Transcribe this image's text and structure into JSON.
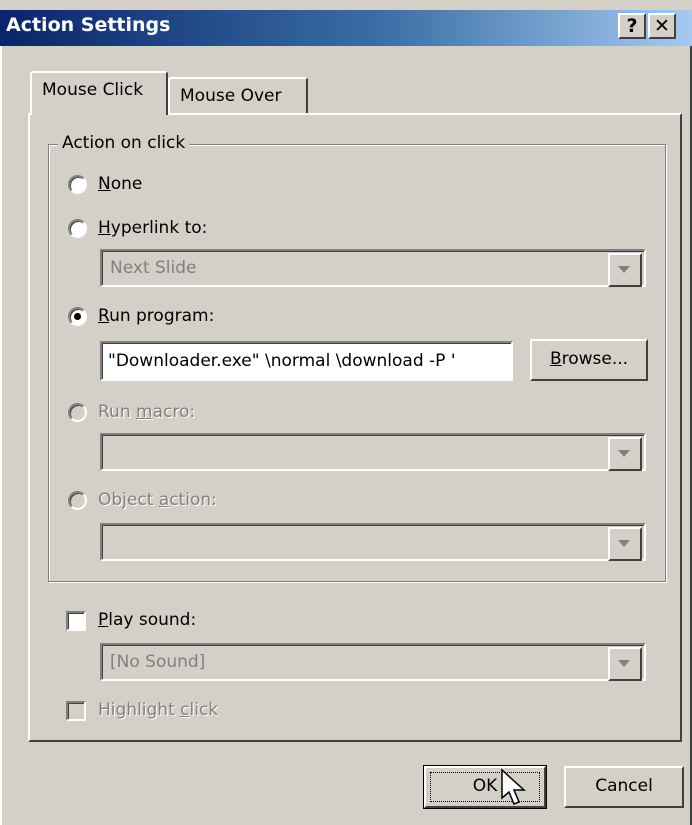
{
  "window": {
    "title": "Action Settings",
    "help_glyph": "?",
    "close_glyph": "✕"
  },
  "tabs": [
    {
      "label": "Mouse Click",
      "active": true
    },
    {
      "label": "Mouse Over",
      "active": false
    }
  ],
  "action_group": {
    "legend": "Action on click",
    "none": {
      "label_pre": "",
      "label_key": "N",
      "label_post": "one"
    },
    "hyperlink": {
      "label_pre": "",
      "label_key": "H",
      "label_post": "yperlink to:",
      "value": "Next Slide"
    },
    "run_program": {
      "label_pre": "",
      "label_key": "R",
      "label_post": "un program:",
      "value": "\"Downloader.exe\" \\normal \\download -P '",
      "browse_pre": "",
      "browse_key": "B",
      "browse_post": "rowse..."
    },
    "run_macro": {
      "label_pre": "Run ",
      "label_key": "m",
      "label_post": "acro:",
      "value": ""
    },
    "object_action": {
      "label_pre": "Object ",
      "label_key": "a",
      "label_post": "ction:",
      "value": ""
    }
  },
  "play_sound": {
    "label_pre": "",
    "label_key": "P",
    "label_post": "lay sound:",
    "value": "[No Sound]"
  },
  "highlight_click": {
    "label_pre": "Highlight ",
    "label_key": "c",
    "label_post": "lick"
  },
  "buttons": {
    "ok": "OK",
    "cancel": "Cancel"
  }
}
